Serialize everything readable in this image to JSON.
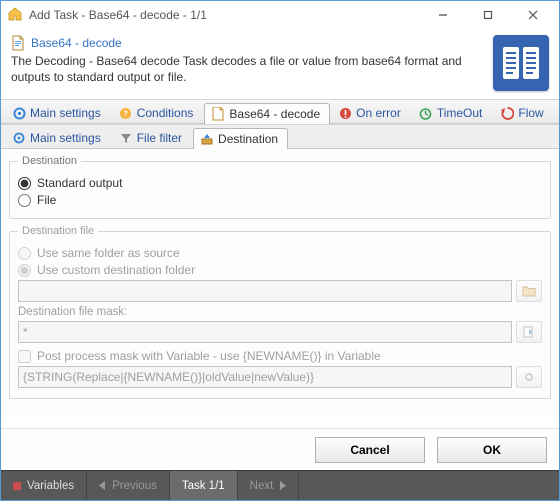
{
  "window": {
    "title": "Add Task - Base64 - decode - 1/1"
  },
  "header": {
    "title": "Base64 - decode",
    "description": "The Decoding - Base64 decode Task decodes a file or value from base64 format and outputs to standard output or file."
  },
  "primary_tabs": {
    "items": [
      {
        "label": "Main settings"
      },
      {
        "label": "Conditions"
      },
      {
        "label": "Base64 - decode"
      },
      {
        "label": "On error"
      },
      {
        "label": "TimeOut"
      },
      {
        "label": "Flow"
      }
    ],
    "active_index": 2
  },
  "secondary_tabs": {
    "items": [
      {
        "label": "Main settings"
      },
      {
        "label": "File filter"
      },
      {
        "label": "Destination"
      }
    ],
    "active_index": 2
  },
  "destination": {
    "legend": "Destination",
    "option_standard": "Standard output",
    "option_file": "File",
    "selected": "standard"
  },
  "destination_file": {
    "legend": "Destination file",
    "option_same": "Use same folder as source",
    "option_custom": "Use custom destination folder",
    "folder_value": "",
    "mask_label": "Destination file mask:",
    "mask_value": "*",
    "post_process_label": "Post process mask with Variable - use {NEWNAME()} in Variable",
    "post_process_value": "{STRING(Replace|{NEWNAME()}|oldValue|newValue)}"
  },
  "buttons": {
    "cancel": "Cancel",
    "ok": "OK"
  },
  "statusbar": {
    "variables": "Variables",
    "previous": "Previous",
    "task": "Task 1/1",
    "next": "Next"
  }
}
